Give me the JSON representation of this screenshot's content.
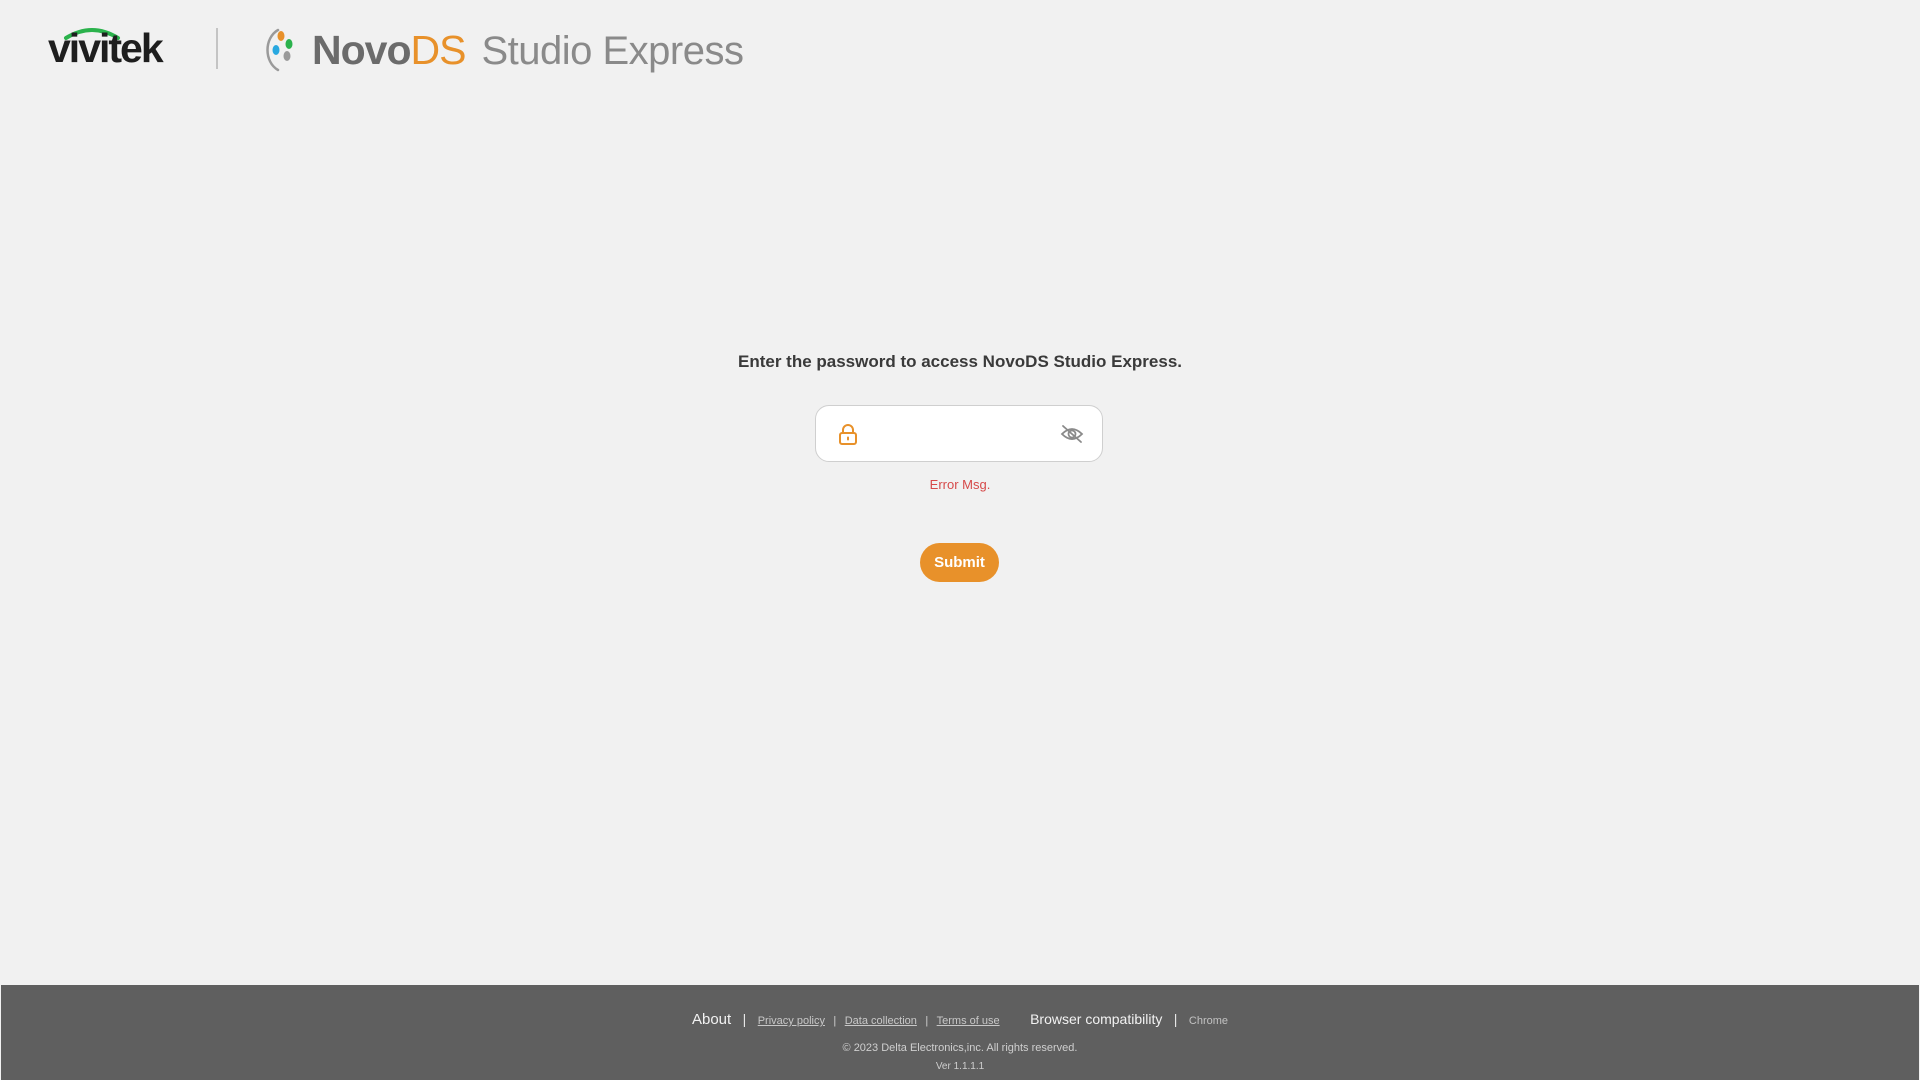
{
  "header": {
    "vivitek_logo": "vivitek",
    "product_name_part1": "Novo",
    "product_name_part2": "DS",
    "product_name_part3": "Studio Express"
  },
  "main": {
    "prompt": "Enter the password to access NovoDS Studio Express.",
    "password_value": "",
    "error_message": "Error Msg.",
    "submit_label": "Submit"
  },
  "footer": {
    "about_label": "About",
    "privacy_label": "Privacy policy",
    "data_collection_label": "Data collection",
    "terms_label": "Terms of use",
    "browser_compat_label": "Browser compatibility",
    "browser_value": "Chrome",
    "copyright": "© 2023 Delta Electronics,inc.  All rights reserved.",
    "version": "Ver 1.1.1.1"
  },
  "colors": {
    "accent": "#e8912a",
    "error": "#d64a4a",
    "footer_bg": "#5f5f5f",
    "page_bg": "#f1f1f1"
  }
}
